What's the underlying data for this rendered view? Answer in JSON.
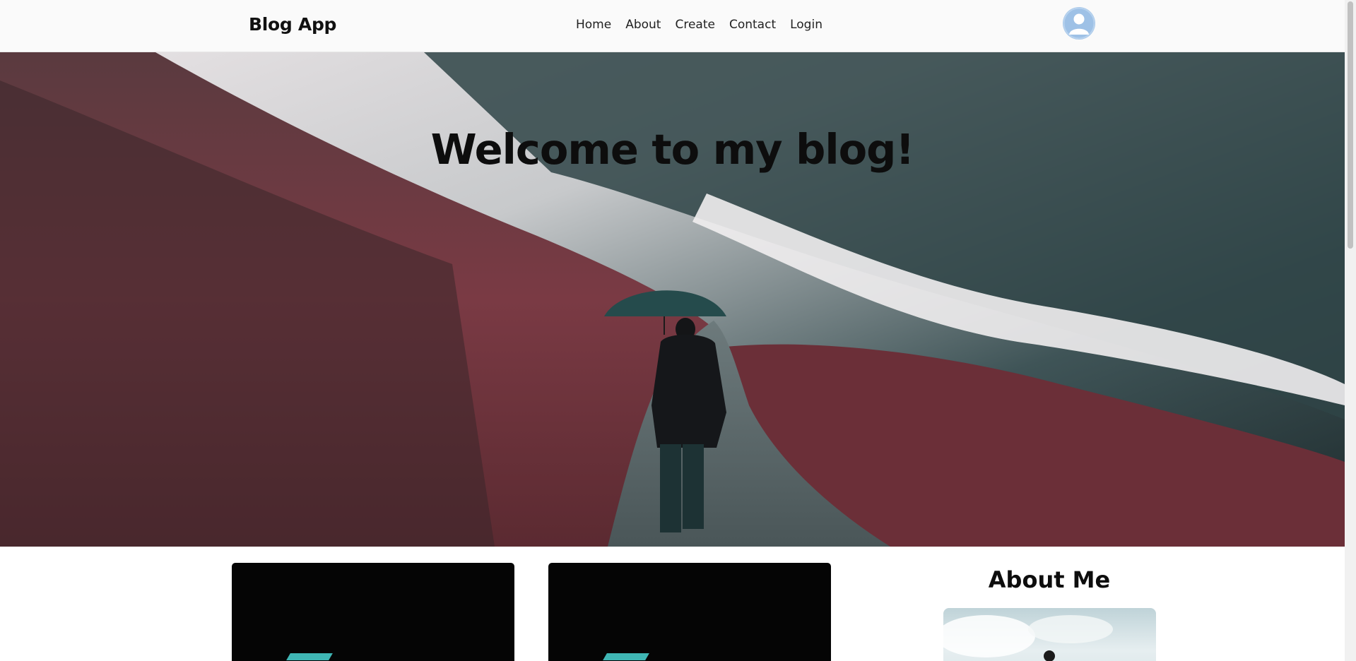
{
  "navbar": {
    "brand": "Blog App",
    "links": [
      "Home",
      "About",
      "Create",
      "Contact",
      "Login"
    ],
    "avatar_icon": "user-avatar-icon"
  },
  "hero": {
    "title": "Welcome to my blog!"
  },
  "sidebar": {
    "about_title": "About Me"
  },
  "colors": {
    "navbar_bg": "#fafafa",
    "text": "#0d0d0d",
    "avatar": "#9ec1e6",
    "card_bg": "#050505",
    "accent_teal": "#3fb6b4"
  }
}
